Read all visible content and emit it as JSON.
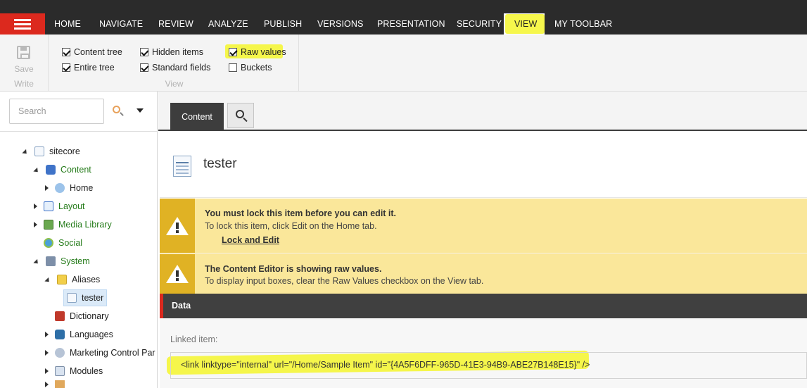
{
  "nav": {
    "tabs": [
      "HOME",
      "NAVIGATE",
      "REVIEW",
      "ANALYZE",
      "PUBLISH",
      "VERSIONS",
      "PRESENTATION",
      "SECURITY",
      "VIEW",
      "MY TOOLBAR"
    ],
    "active_tab": "VIEW"
  },
  "ribbon": {
    "save_label": "Save",
    "write_label": "Write",
    "view_group_caption": "View",
    "checkboxes": [
      {
        "label": "Content tree",
        "checked": true
      },
      {
        "label": "Entire tree",
        "checked": true
      },
      {
        "label": "Hidden items",
        "checked": true
      },
      {
        "label": "Standard fields",
        "checked": true
      },
      {
        "label": "Raw values",
        "checked": true
      },
      {
        "label": "Buckets",
        "checked": false
      }
    ]
  },
  "search": {
    "placeholder": "Search"
  },
  "tree": [
    {
      "label": "sitecore",
      "icon": "document-icon",
      "toggle": "open",
      "green": false
    },
    {
      "label": "Content",
      "icon": "content-icon",
      "toggle": "open",
      "green": true
    },
    {
      "label": "Home",
      "icon": "home-icon",
      "toggle": "closed",
      "green": false
    },
    {
      "label": "Layout",
      "icon": "layout-icon",
      "toggle": "closed",
      "green": true
    },
    {
      "label": "Media Library",
      "icon": "image-icon",
      "toggle": "closed",
      "green": true
    },
    {
      "label": "Social",
      "icon": "globe-icon",
      "toggle": "none",
      "green": true
    },
    {
      "label": "System",
      "icon": "system-icon",
      "toggle": "open",
      "green": true
    },
    {
      "label": "Aliases",
      "icon": "folder-icon",
      "toggle": "open",
      "green": false
    },
    {
      "label": "tester",
      "icon": "document-icon",
      "toggle": "none",
      "green": false,
      "selected": true
    },
    {
      "label": "Dictionary",
      "icon": "book-icon",
      "toggle": "none",
      "green": false
    },
    {
      "label": "Languages",
      "icon": "globe-icon",
      "toggle": "closed",
      "green": false
    },
    {
      "label": "Marketing Control Par",
      "icon": "marketing-icon",
      "toggle": "closed",
      "green": false
    },
    {
      "label": "Modules",
      "icon": "modules-icon",
      "toggle": "closed",
      "green": false
    }
  ],
  "editor": {
    "tab_content": "Content",
    "item_title": "tester",
    "warning1": {
      "title": "You must lock this item before you can edit it.",
      "text": "To lock this item, click Edit on the Home tab.",
      "link": "Lock and Edit"
    },
    "warning2": {
      "title": "The Content Editor is showing raw values.",
      "text": "To display input boxes, clear the Raw Values checkbox on the View tab."
    },
    "section_title": "Data",
    "field_label": "Linked item:",
    "field_value": "<link linktype=\"internal\" url=\"/Home/Sample Item\" id=\"{4A5F6DFF-965D-41E3-94B9-ABE27B148E15}\" />"
  },
  "colors": {
    "accent_red": "#dc291e",
    "highlight": "#f4f62d",
    "warning_bg": "#fae79a",
    "warning_icon": "#e0b224",
    "tree_green": "#257b1a"
  }
}
